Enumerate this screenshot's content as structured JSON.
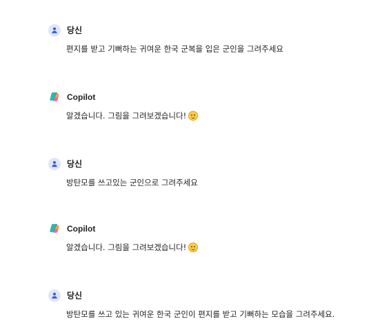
{
  "messages": [
    {
      "author": "당신",
      "role": "user",
      "text": "편지를 받고 기뻐하는 귀여운 한국 군복을 입은 군인을 그려주세요",
      "emoji": false
    },
    {
      "author": "Copilot",
      "role": "assistant",
      "text": "알겠습니다. 그림을 그려보겠습니다!",
      "emoji": true
    },
    {
      "author": "당신",
      "role": "user",
      "text": "방탄모를 쓰고있는 군인으로 그려주세요",
      "emoji": false
    },
    {
      "author": "Copilot",
      "role": "assistant",
      "text": "알겠습니다. 그림을 그려보겠습니다!",
      "emoji": true
    },
    {
      "author": "당신",
      "role": "user",
      "text": "방탄모를 쓰고 있는 귀여운 한국 군인이 편지를 받고 기뻐하는 모습을 그려주세요.",
      "emoji": false
    }
  ],
  "icons": {
    "user_avatar": "person-icon",
    "copilot_avatar": "copilot-logo-icon",
    "emoji": "smiling-face-emoji"
  },
  "colors": {
    "user_avatar_bg": "#dfe6fb",
    "user_avatar_fg": "#3b5bdb",
    "text": "#1f1f1f"
  }
}
